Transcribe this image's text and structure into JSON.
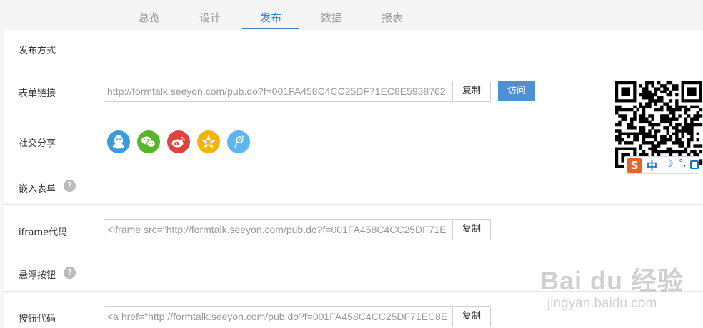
{
  "tabs": [
    {
      "label": "总览"
    },
    {
      "label": "设计"
    },
    {
      "label": "发布"
    },
    {
      "label": "数据"
    },
    {
      "label": "报表"
    }
  ],
  "active_tab": "发布",
  "publish": {
    "section_title": "发布方式",
    "link_label": "表单链接",
    "link_value": "http://formtalk.seeyon.com/pub.do?f=001FA458C4CC25DF71EC8E5938762",
    "copy_label": "复制",
    "visit_label": "访问",
    "share_label": "社交分享",
    "share_icons": [
      "qq-icon",
      "wechat-icon",
      "weibo-icon",
      "qzone-icon",
      "tencent-weibo-icon"
    ]
  },
  "embed": {
    "section_title": "嵌入表单",
    "help": "?",
    "iframe_label": "iframe代码",
    "iframe_value": "<iframe src=\"http://formtalk.seeyon.com/pub.do?f=001FA458C4CC25DF71E",
    "copy_label": "复制"
  },
  "float_button": {
    "section_title": "悬浮按钮",
    "help": "?",
    "code_label": "按钮代码",
    "code_value": "<a href=\"http://formtalk.seeyon.com/pub.do?f=001FA458C4CC25DF71EC8E",
    "copy_label": "复制"
  },
  "ime_toolbar": {
    "logo": "S",
    "mode": "中",
    "moon": "☽",
    "punct": "°,"
  },
  "watermark": {
    "logo": "Bai du 经验",
    "url": "jingyan.baidu.com"
  },
  "colors": {
    "accent": "#3f83c4",
    "visit_button": "#4f8fd5",
    "qq": "#3a9be0",
    "wechat": "#58b52a",
    "weibo": "#e0433c",
    "qzone": "#f5b400",
    "tencent_weibo": "#5db5ef"
  }
}
